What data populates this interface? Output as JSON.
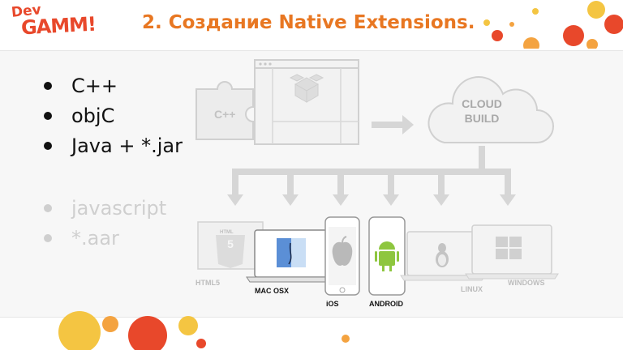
{
  "logo": {
    "line1": "Dev",
    "line2": "GAMM!"
  },
  "title": "2. Создание Native Extensions.",
  "bullets": [
    {
      "text": "C++",
      "active": true
    },
    {
      "text": "objC",
      "active": true
    },
    {
      "text": "Java + *.jar",
      "active": true
    },
    {
      "text": "javascript",
      "active": false
    },
    {
      "text": "*.aar",
      "active": false
    }
  ],
  "diagram": {
    "source_label": "C++",
    "cloud_line1": "CLOUD",
    "cloud_line2": "BUILD",
    "html5_badge": "HTML",
    "platforms": {
      "html5": "HTML5",
      "macosx": "MAC OSX",
      "ios": "iOS",
      "android": "ANDROID",
      "linux": "LINUX",
      "windows": "WINDOWS"
    }
  },
  "colors": {
    "accent": "#e87722",
    "brand": "#e8482b",
    "diagram_gray": "#d4d4d4"
  }
}
